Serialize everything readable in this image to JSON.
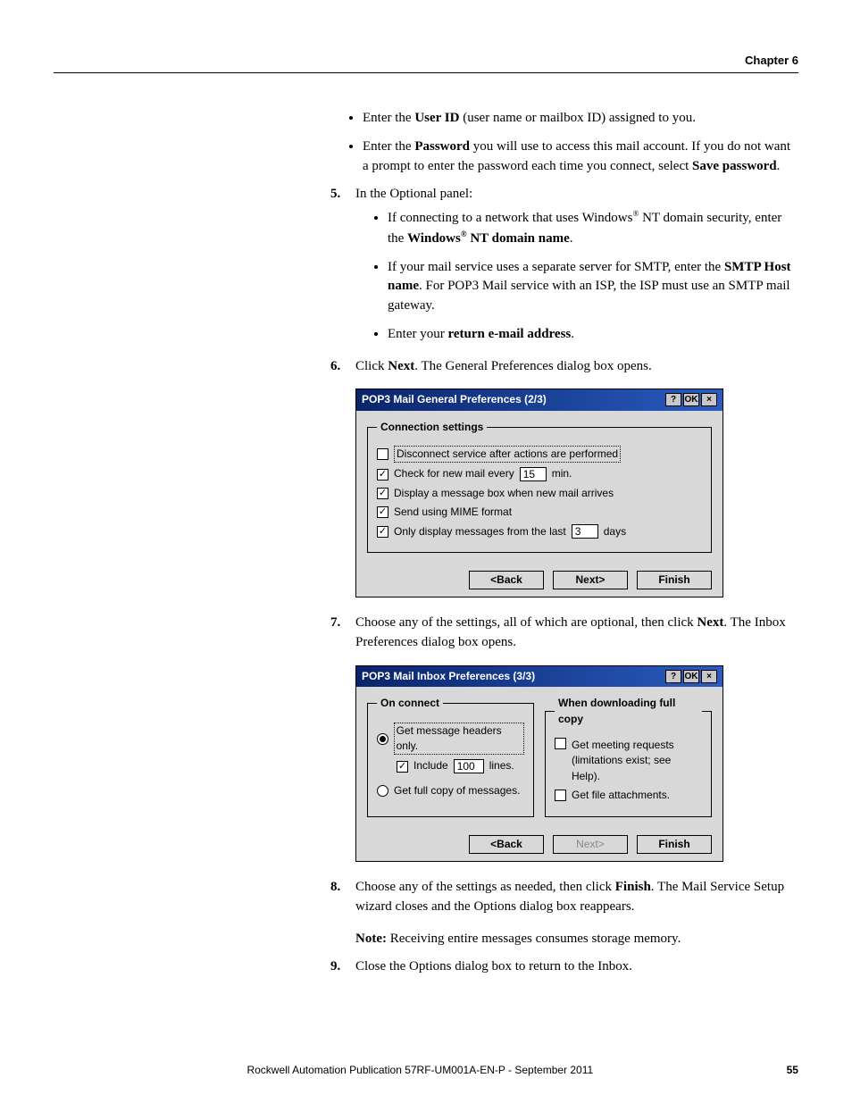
{
  "header": {
    "chapter": "Chapter 6"
  },
  "bullets_pre": [
    {
      "pre": "Enter the ",
      "bold": "User ID",
      "post": " (user name or mailbox ID) assigned to you."
    },
    {
      "pre": "Enter the ",
      "bold": "Password",
      "post": " you will use to access this mail account. If you do not want a prompt to enter the password each time you connect, select ",
      "bold2": "Save password",
      "post2": "."
    }
  ],
  "step5": {
    "num": "5.",
    "intro": "In the Optional panel:",
    "bullets": {
      "b1_pre": "If connecting to a network that uses Windows",
      "b1_mid": " NT domain security, enter the ",
      "b1_bold_pre": "Windows",
      "b1_bold_post": " NT domain name",
      "b1_end": ".",
      "b2_pre": "If your mail service uses a separate server for SMTP, enter the ",
      "b2_bold": "SMTP Host name",
      "b2_post": ". For POP3 Mail service with an ISP, the ISP must use an SMTP mail gateway.",
      "b3_pre": "Enter your ",
      "b3_bold": "return e-mail address",
      "b3_post": "."
    }
  },
  "step6": {
    "num": "6.",
    "pre": "Click ",
    "bold": "Next",
    "post": ". The General Preferences dialog box opens."
  },
  "dlg1": {
    "title": "POP3 Mail General Preferences (2/3)",
    "help": "?",
    "ok": "OK",
    "close": "×",
    "group": "Connection settings",
    "opt1": "Disconnect service after actions are performed",
    "opt2a": "Check for new mail every",
    "opt2val": "15",
    "opt2b": "min.",
    "opt3": "Display a message box when new mail arrives",
    "opt4": "Send using MIME format",
    "opt5a": "Only display messages from the last",
    "opt5val": "3",
    "opt5b": "days",
    "back": "<Back",
    "next": "Next>",
    "finish": "Finish"
  },
  "step7": {
    "num": "7.",
    "pre": "Choose any of the settings, all of which are optional, then click ",
    "bold": "Next",
    "post": ". The Inbox Preferences dialog box opens."
  },
  "dlg2": {
    "title": "POP3 Mail Inbox Preferences (3/3)",
    "help": "?",
    "ok": "OK",
    "close": "×",
    "group1": "On connect",
    "r1": "Get message headers only.",
    "inc_a": "Include",
    "inc_val": "100",
    "inc_b": "lines.",
    "r2": "Get full copy of messages.",
    "group2": "When downloading full copy",
    "c1a": "Get meeting requests",
    "c1b": "(limitations exist; see Help).",
    "c2": "Get file attachments.",
    "back": "<Back",
    "next": "Next>",
    "finish": "Finish"
  },
  "step8": {
    "num": "8.",
    "pre": "Choose any of the settings as needed, then click ",
    "bold": "Finish",
    "post": ". The Mail Service Setup wizard closes and the Options dialog box reappears."
  },
  "note": {
    "label": "Note:",
    "text": " Receiving entire messages consumes storage memory."
  },
  "step9": {
    "num": "9.",
    "text": "Close the Options dialog box to return to the Inbox."
  },
  "footer": {
    "pub": "Rockwell Automation Publication 57RF-UM001A-EN-P - September 2011",
    "page": "55"
  }
}
